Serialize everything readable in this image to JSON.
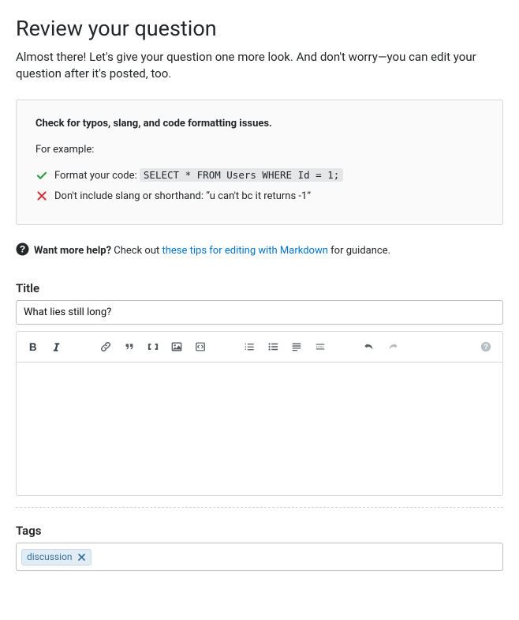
{
  "heading": "Review your question",
  "subtitle": "Almost there! Let's give your question one more look. And don't worry—you can edit your question after it's posted, too.",
  "tips": {
    "title": "Check for typos, slang, and code formatting issues.",
    "for_example": "For example:",
    "format_prefix": "Format your code: ",
    "format_code": "SELECT * FROM Users WHERE Id = 1;",
    "no_slang": "Don't include slang or shorthand: “u can't bc it returns -1”"
  },
  "want_help": {
    "bold": "Want more help?",
    "before": "Check out ",
    "link": "these tips for editing with Markdown",
    "after": " for guidance."
  },
  "title_field": {
    "label": "Title",
    "value": "What lies still long?"
  },
  "tags_field": {
    "label": "Tags",
    "tags": [
      "discussion"
    ]
  }
}
